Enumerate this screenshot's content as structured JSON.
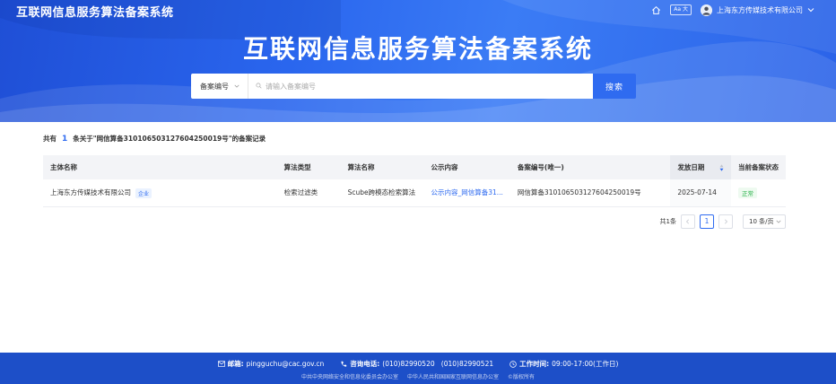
{
  "header": {
    "site_title": "互联网信息服务算法备案系统",
    "font_toggle": "Aa 大",
    "company": "上海东方传媒技术有限公司"
  },
  "hero": {
    "title": "互联网信息服务算法备案系统"
  },
  "search": {
    "select_label": "备案编号",
    "placeholder": "请输入备案编号",
    "button": "搜索"
  },
  "summary": {
    "prefix": "共有",
    "count": "1",
    "suffix": "条关于\"网信算备310106503127604250019号\"的备案记录"
  },
  "table": {
    "columns": [
      "主体名称",
      "算法类型",
      "算法名称",
      "公示内容",
      "备案编号(唯一)",
      "发放日期",
      "当前备案状态"
    ],
    "rows": [
      {
        "entity": "上海东方传媒技术有限公司",
        "entity_tag": "企业",
        "type": "检索过滤类",
        "name": "Scube跨模态检索算法",
        "content": "公示内容_网信算备31...",
        "record_no": "网信算备310106503127604250019号",
        "date": "2025-07-14",
        "status": "正常"
      }
    ]
  },
  "pagination": {
    "total": "共1条",
    "current": "1",
    "page_size": "10 条/页"
  },
  "footer": {
    "email_label": "邮箱:",
    "email": "pingguchu@cac.gov.cn",
    "phone_label": "咨询电话:",
    "phones": "(010)82990520   (010)82990521",
    "hours_label": "工作时间:",
    "hours": "09:00-17:00(工作日)",
    "org1": "中共中央网络安全和信息化委员会办公室",
    "org2": "中华人民共和国国家互联网信息办公室",
    "copyright": "©版权所有"
  },
  "colors": {
    "brand_blue": "#2f6bf0",
    "footer_blue": "#1d4fc8",
    "status_green": "#27b148"
  }
}
